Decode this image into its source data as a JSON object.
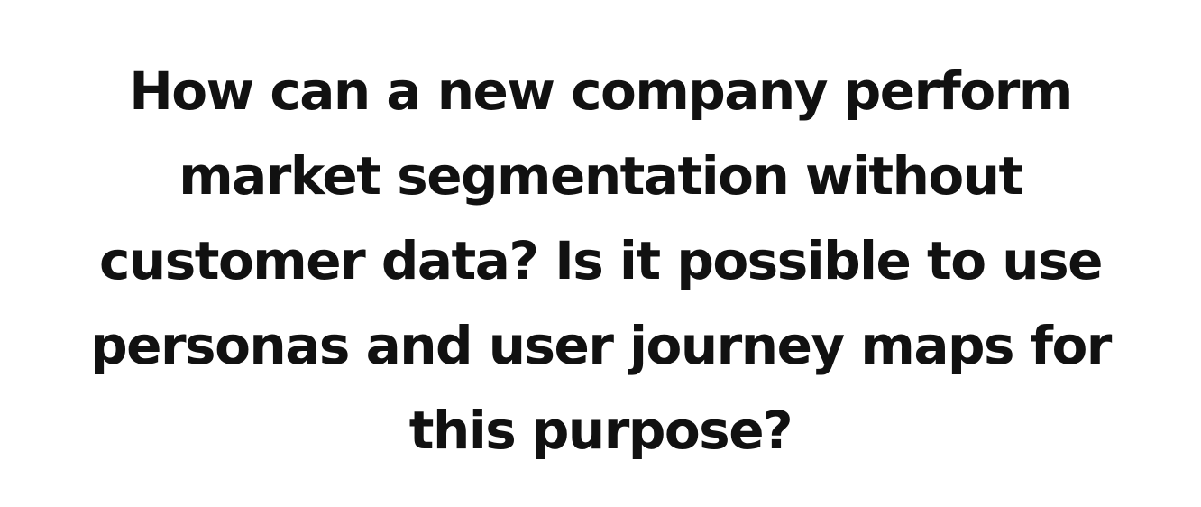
{
  "question": {
    "lines": [
      "How can a new company perform",
      "market segmentation without",
      "customer data? Is it possible to use",
      "personas and user journey maps for",
      "this purpose?"
    ]
  },
  "colors": {
    "background": "#ffffff",
    "text": "#111111"
  }
}
